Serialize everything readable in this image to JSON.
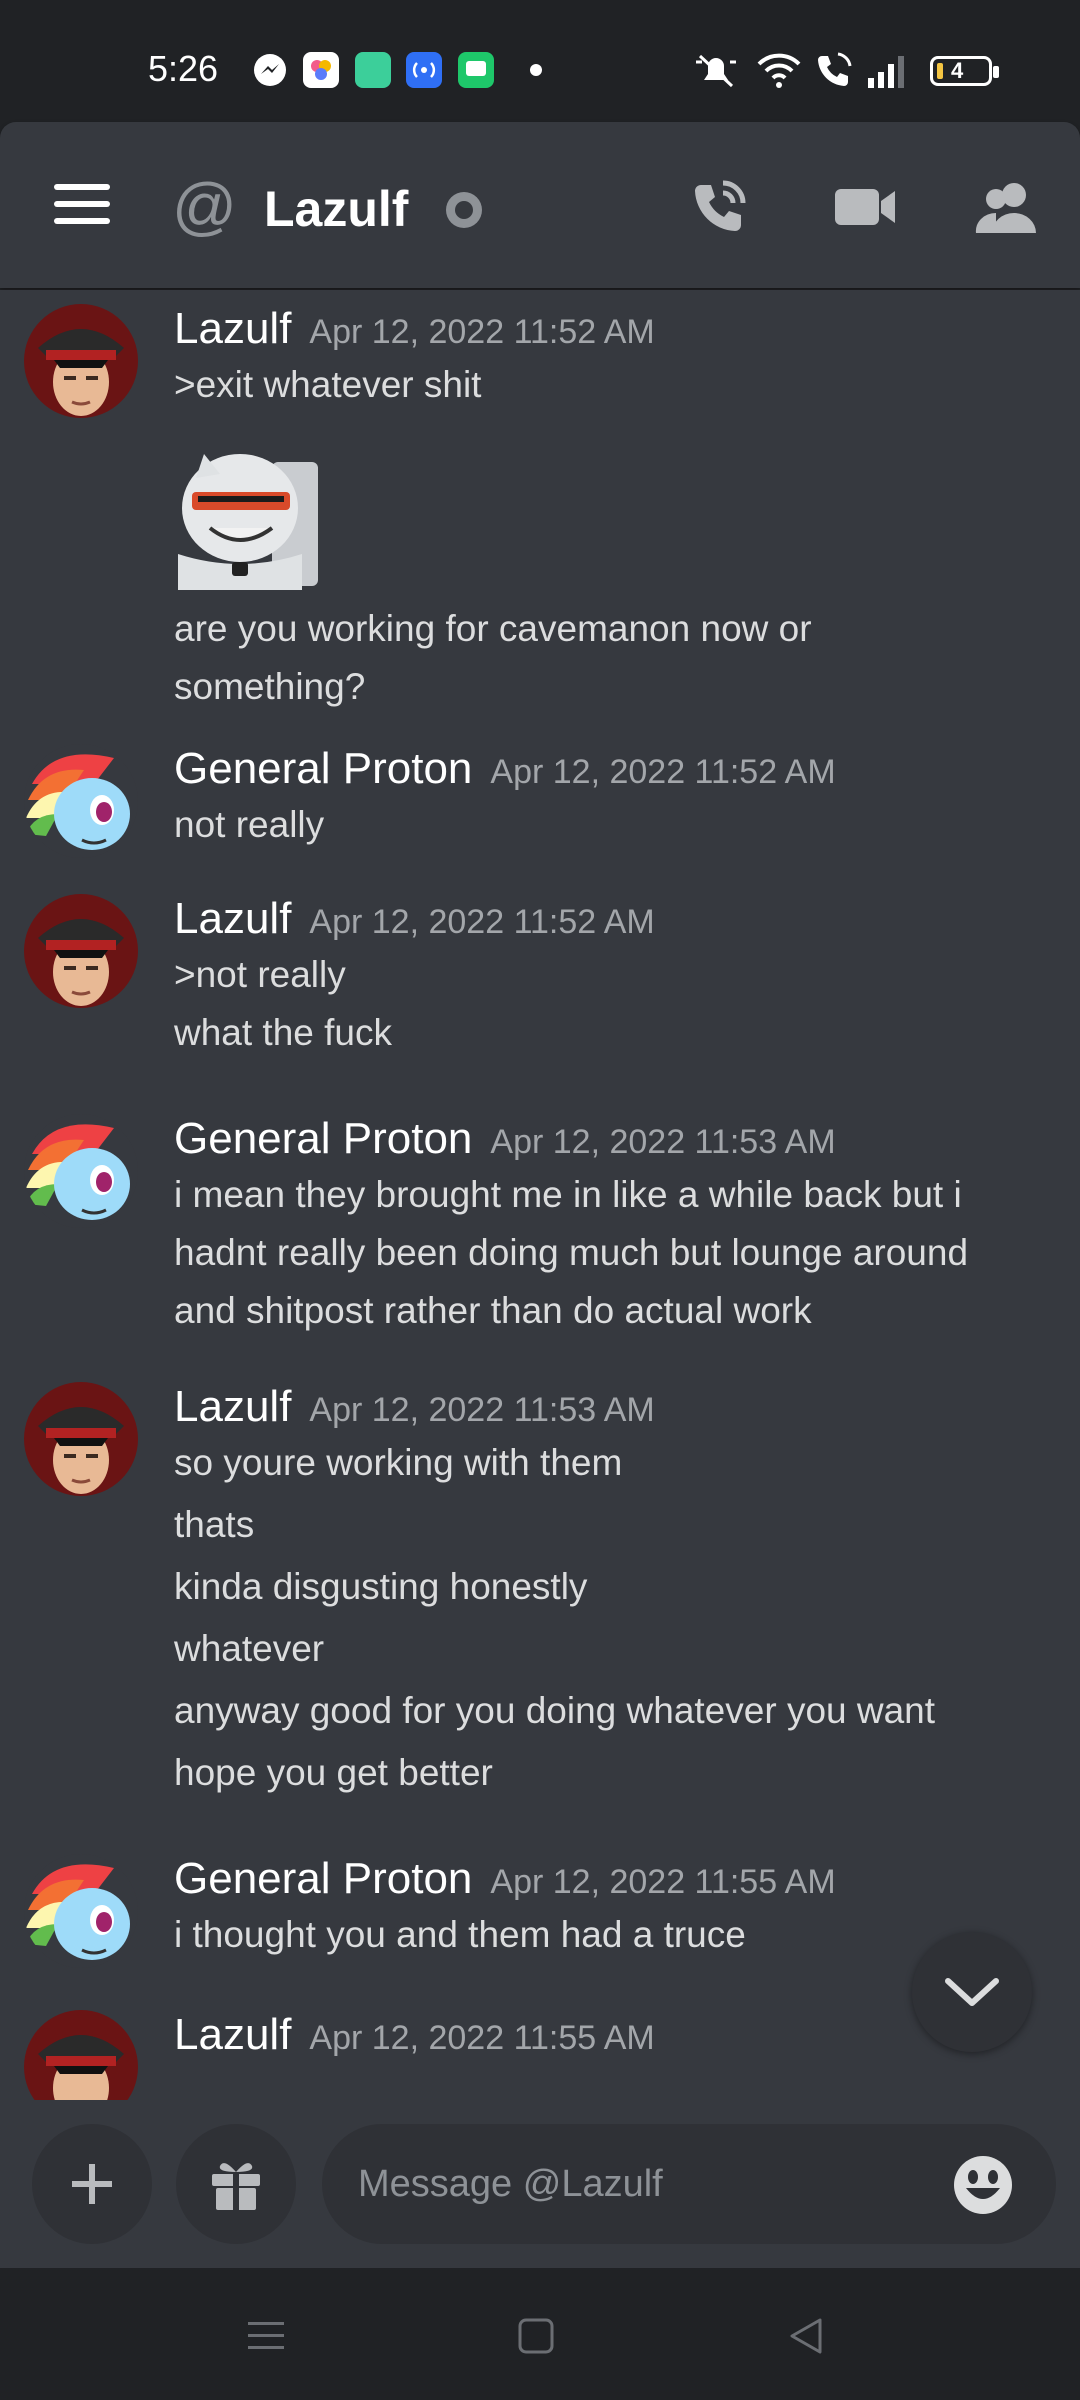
{
  "status_bar": {
    "time": "5:26",
    "battery_level": "4",
    "right_icons": [
      "mute-icon",
      "wifi-icon",
      "wifi-call-icon",
      "signal-icon",
      "battery-icon"
    ]
  },
  "header": {
    "title": "Lazulf",
    "channel_icon": "at-icon",
    "status": "offline"
  },
  "messages": [
    {
      "author": "Lazulf",
      "timestamp": "Apr 12, 2022 11:52 AM",
      "lines": [
        ">exit whatever shit"
      ],
      "has_sticker": true,
      "lines_after": [
        "are you working for cavemanon now or",
        "something?"
      ]
    },
    {
      "author": "General Proton",
      "timestamp": "Apr 12, 2022 11:52 AM",
      "lines": [
        "not really"
      ]
    },
    {
      "author": "Lazulf",
      "timestamp": "Apr 12, 2022 11:52 AM",
      "lines": [
        ">not really",
        "what the fuck"
      ]
    },
    {
      "author": "General Proton",
      "timestamp": "Apr 12, 2022 11:53 AM",
      "lines": [
        "i mean they brought me in like a while back but i",
        "hadnt really been doing much but lounge around",
        "and shitpost rather than do actual work"
      ]
    },
    {
      "author": "Lazulf",
      "timestamp": "Apr 12, 2022 11:53 AM",
      "lines": [
        "so youre working with them",
        "thats",
        "kinda disgusting honestly",
        "whatever",
        "anyway good for you doing whatever you want",
        "hope you get better"
      ]
    },
    {
      "author": "General Proton",
      "timestamp": "Apr 12, 2022 11:55 AM",
      "lines": [
        "i thought you and them had a truce"
      ]
    },
    {
      "author": "Lazulf",
      "timestamp": "Apr 12, 2022 11:55 AM",
      "lines": []
    }
  ],
  "composer": {
    "placeholder": "Message @Lazulf"
  },
  "colors": {
    "background": "#36393f",
    "chrome": "#202225",
    "input_bg": "#2f3136",
    "text": "#dcddde",
    "muted": "#a3a6aa"
  }
}
